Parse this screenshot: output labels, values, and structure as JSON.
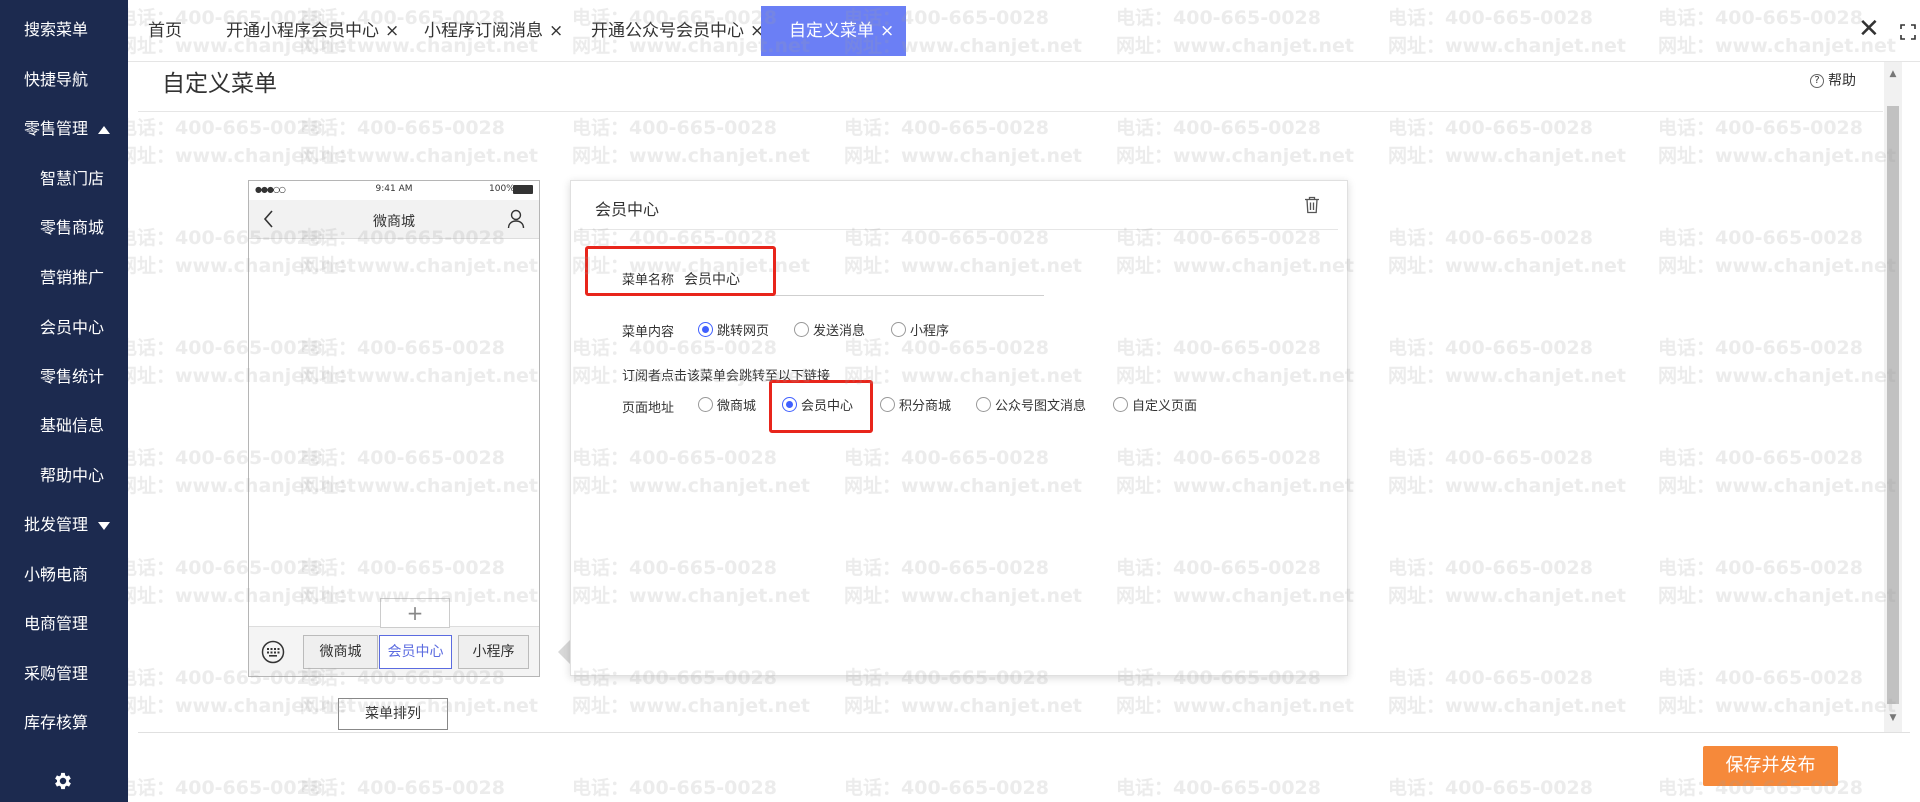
{
  "sidebar": {
    "items": [
      {
        "label": "搜索菜单",
        "level": "top"
      },
      {
        "label": "快捷导航",
        "level": "top"
      },
      {
        "label": "零售管理",
        "level": "top",
        "caret": "up"
      },
      {
        "label": "智慧门店",
        "level": "sub"
      },
      {
        "label": "零售商城",
        "level": "sub"
      },
      {
        "label": "营销推广",
        "level": "sub"
      },
      {
        "label": "会员中心",
        "level": "sub"
      },
      {
        "label": "零售统计",
        "level": "sub"
      },
      {
        "label": "基础信息",
        "level": "sub"
      },
      {
        "label": "帮助中心",
        "level": "sub"
      },
      {
        "label": "批发管理",
        "level": "top",
        "caret": "down"
      },
      {
        "label": "小畅电商",
        "level": "top"
      },
      {
        "label": "电商管理",
        "level": "top"
      },
      {
        "label": "采购管理",
        "level": "top"
      },
      {
        "label": "库存核算",
        "level": "top"
      }
    ],
    "settings_icon": "gear-icon"
  },
  "tabs": [
    {
      "label": "首页",
      "closable": false,
      "active": false
    },
    {
      "label": "开通小程序会员中心",
      "closable": true,
      "active": false
    },
    {
      "label": "小程序订阅消息",
      "closable": true,
      "active": false
    },
    {
      "label": "开通公众号会员中心",
      "closable": true,
      "active": false
    },
    {
      "label": "自定义菜单",
      "closable": true,
      "active": true
    }
  ],
  "tab_close_glyph": "×",
  "window_close_glyph": "✕",
  "page": {
    "title": "自定义菜单",
    "help_label": "帮助"
  },
  "phone": {
    "status_time": "9:41 AM",
    "status_battery": "100%",
    "status_signal": "●●●○○ ",
    "nav_title": "微商城",
    "add_glyph": "+",
    "menus": [
      "微商城",
      "会员中心",
      "小程序"
    ],
    "selected_menu": "会员中心"
  },
  "sort_button_label": "菜单排列",
  "editor": {
    "title": "会员中心",
    "name_label": "菜单名称",
    "name_value": "会员中心",
    "content_label": "菜单内容",
    "content_options": [
      "跳转网页",
      "发送消息",
      "小程序"
    ],
    "content_selected": "跳转网页",
    "hint": "订阅者点击该菜单会跳转至以下链接",
    "page_label": "页面地址",
    "page_options": [
      "微商城",
      "会员中心",
      "积分商城",
      "公众号图文消息",
      "自定义页面"
    ],
    "page_selected": "会员中心"
  },
  "save_button_label": "保存并发布",
  "watermark": {
    "line1": "电话：400-665-0028",
    "line2": "网址：www.chanjet.net"
  },
  "colors": {
    "sidebar_bg": "#1c2a4f",
    "active_tab_bg": "#6b7ff5",
    "save_button_bg": "#f6893a",
    "highlight": "#e8251b",
    "radio_selected": "#4060ff"
  }
}
